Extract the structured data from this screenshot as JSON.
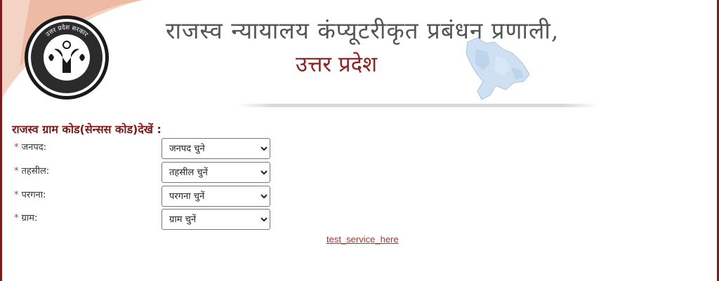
{
  "header": {
    "title_line1": "राजस्व न्यायालय कंप्यूटरीकृत प्रबंधन प्रणाली,",
    "title_line2": "उत्तर प्रदेश",
    "emblem_text": "उत्तर प्रदेश सरकार",
    "emblem_icon": "up-govt-emblem-icon",
    "map_icon": "up-state-map-icon"
  },
  "form": {
    "heading": "राजस्व ग्राम कोड(सेन्सस कोड)देखें :",
    "required_mark": "*",
    "fields": [
      {
        "label": "जनपद:",
        "selected": "जनपद चुने"
      },
      {
        "label": "तहसील:",
        "selected": "तहसील चुनें"
      },
      {
        "label": "परगना:",
        "selected": "परगना चुनें"
      },
      {
        "label": "ग्राम:",
        "selected": "ग्राम चुनें"
      }
    ]
  },
  "link": {
    "text": "test_service_here"
  },
  "colors": {
    "brand_maroon": "#7a1c1c",
    "title_gray": "#555555",
    "title_red": "#8a2424",
    "link_red": "#b0302a",
    "required_red": "#c0392b"
  }
}
